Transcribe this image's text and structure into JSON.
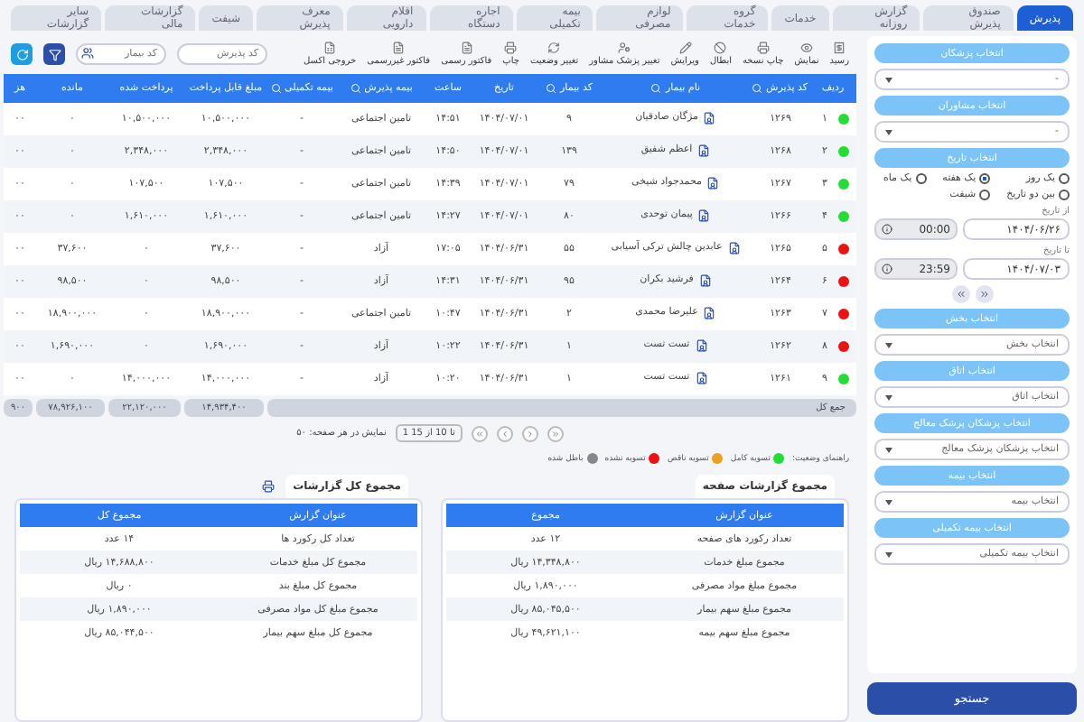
{
  "tabs": [
    {
      "label": "پذیرش",
      "selected": true
    },
    {
      "label": "صندوق پذیرش",
      "selected": false
    },
    {
      "label": "گزارش روزانه",
      "selected": false
    },
    {
      "label": "خدمات",
      "selected": false
    },
    {
      "label": "گروه خدمات",
      "selected": false
    },
    {
      "label": "لوازم مصرفی",
      "selected": false
    },
    {
      "label": "بیمه تکمیلی",
      "selected": false
    },
    {
      "label": "اجاره دستگاه",
      "selected": false
    },
    {
      "label": "اقلام دارویی",
      "selected": false
    },
    {
      "label": "معرف پذیرش",
      "selected": false
    },
    {
      "label": "شیفت",
      "selected": false
    },
    {
      "label": "گزارشات مالی",
      "selected": false
    },
    {
      "label": "سایر گزارشات",
      "selected": false
    }
  ],
  "toolbar": [
    {
      "label": "رسید"
    },
    {
      "label": "نمایش"
    },
    {
      "label": "چاپ نسخه"
    },
    {
      "label": "ابطال"
    },
    {
      "label": "ویرایش"
    },
    {
      "label": "تغییر پزشک مشاور"
    },
    {
      "label": "تغییر وضعیت"
    },
    {
      "label": "چاپ"
    },
    {
      "label": "فاکتور رسمی"
    },
    {
      "label": "فاکتور غیررسمی"
    },
    {
      "label": "خروجی اکسل"
    }
  ],
  "filters": {
    "admission_code": {
      "placeholder": "کد پذیرش"
    },
    "patient_code": {
      "placeholder": "کد بیمار"
    }
  },
  "table": {
    "columns": [
      {
        "label": "ردیف",
        "searchable": false
      },
      {
        "label": "کد پذیرش",
        "searchable": true
      },
      {
        "label": "نام بیمار",
        "searchable": true
      },
      {
        "label": "کد بیمار",
        "searchable": true
      },
      {
        "label": "تاریخ",
        "searchable": false
      },
      {
        "label": "ساعت",
        "searchable": false
      },
      {
        "label": "بیمه پذیرش",
        "searchable": true
      },
      {
        "label": "بیمه تکمیلی",
        "searchable": true
      },
      {
        "label": "مبلغ قابل پرداخت",
        "searchable": false
      },
      {
        "label": "پرداخت شده",
        "searchable": false
      },
      {
        "label": "مانده",
        "searchable": false
      },
      {
        "label": "هز",
        "searchable": false
      }
    ],
    "rows": [
      {
        "color": "#22dd33",
        "cells": [
          "۱",
          "۱۲۶۹",
          "مژگان صادقیان",
          "۹",
          "۱۴۰۴/۰۷/۰۱",
          "۱۴:۵۱",
          "تامین اجتماعی",
          "-",
          "۱۰,۵۰۰,۰۰۰",
          "۱۰,۵۰۰,۰۰۰",
          "۰",
          "۰۰"
        ]
      },
      {
        "color": "#22dd33",
        "cells": [
          "۲",
          "۱۲۶۸",
          "اعظم شفیق",
          "۱۳۹",
          "۱۴۰۴/۰۷/۰۱",
          "۱۴:۵۰",
          "تامین اجتماعی",
          "-",
          "۲,۳۴۸,۰۰۰",
          "۲,۳۴۸,۰۰۰",
          "۰",
          "۰۰"
        ]
      },
      {
        "color": "#22dd33",
        "cells": [
          "۳",
          "۱۲۶۷",
          "محمدجواد شیخی",
          "۷۹",
          "۱۴۰۴/۰۷/۰۱",
          "۱۴:۳۹",
          "تامین اجتماعی",
          "-",
          "۱۰۷,۵۰۰",
          "۱۰۷,۵۰۰",
          "۰",
          "۰۰"
        ]
      },
      {
        "color": "#22dd33",
        "cells": [
          "۴",
          "۱۲۶۶",
          "پیمان توحدی",
          "۸۰",
          "۱۴۰۴/۰۷/۰۱",
          "۱۴:۲۷",
          "تامین اجتماعی",
          "-",
          "۱,۶۱۰,۰۰۰",
          "۱,۶۱۰,۰۰۰",
          "۰",
          "۰۰"
        ]
      },
      {
        "color": "#ee1111",
        "cells": [
          "۵",
          "۱۲۶۵",
          "عابدین چالش ترکی آسیابی",
          "۵۵",
          "۱۴۰۴/۰۶/۳۱",
          "۱۷:۰۵",
          "آزاد",
          "-",
          "۳۷,۶۰۰",
          "۰",
          "۳۷,۶۰۰",
          "۰۰"
        ]
      },
      {
        "color": "#ee1111",
        "cells": [
          "۶",
          "۱۲۶۴",
          "فرشید بکران",
          "۹۵",
          "۱۴۰۴/۰۶/۳۱",
          "۱۴:۳۱",
          "آزاد",
          "-",
          "۹۸,۵۰۰",
          "۰",
          "۹۸,۵۰۰",
          "۰۰"
        ]
      },
      {
        "color": "#ee1111",
        "cells": [
          "۷",
          "۱۲۶۳",
          "علیرضا محمدی",
          "۲",
          "۱۴۰۴/۰۶/۳۱",
          "۱۰:۴۷",
          "تامین اجتماعی",
          "-",
          "۱۸,۹۰۰,۰۰۰",
          "۰",
          "۱۸,۹۰۰,۰۰۰",
          "۰۰"
        ]
      },
      {
        "color": "#ee1111",
        "cells": [
          "۸",
          "۱۲۶۲",
          "تست تست",
          "۱",
          "۱۴۰۴/۰۶/۳۱",
          "۱۰:۲۲",
          "آزاد",
          "-",
          "۱,۶۹۰,۰۰۰",
          "۰",
          "۱,۶۹۰,۰۰۰",
          "۰۰"
        ]
      },
      {
        "color": "#22dd33",
        "cells": [
          "۹",
          "۱۲۶۱",
          "تست تست",
          "۱",
          "۱۴۰۴/۰۶/۳۱",
          "۱۰:۲۰",
          "آزاد",
          "-",
          "۱۴,۰۰۰,۰۰۰",
          "۱۴,۰۰۰,۰۰۰",
          "۰",
          "۰۰"
        ]
      }
    ],
    "totals": {
      "label": "جمع کل",
      "values": [
        "۱۴,۹۳۴,۴۰۰",
        "۲۲,۱۲۰,۰۰۰",
        "۷۸,۹۲۶,۱۰۰",
        "۹۰۰"
      ]
    }
  },
  "pagination": {
    "range": "1 تا 10 از 15",
    "page_size": "نمایش در هر صفحه: ۵۰"
  },
  "legend": {
    "title": "راهنمای وضعیت:",
    "items": [
      {
        "label": "تسویه کامل",
        "color": "#22dd33"
      },
      {
        "label": "تسویه ناقص",
        "color": "#f0a020"
      },
      {
        "label": "تسویه نشده",
        "color": "#ee1111"
      },
      {
        "label": "باطل شده",
        "color": "#888888"
      }
    ]
  },
  "summaries": [
    {
      "title": "مجموع گزارشات صفحه",
      "printable": false,
      "columns": [
        "عنوان گزارش",
        "مجموع"
      ],
      "rows": [
        [
          "تعداد رکورد های صفحه",
          "۱۲ عدد"
        ],
        [
          "مجموع مبلغ خدمات",
          "۱۴,۳۴۸,۸۰۰ ریال"
        ],
        [
          "مجموع مبلغ مواد مصرفی",
          "۱,۸۹۰,۰۰۰ ریال"
        ],
        [
          "مجموع مبلغ سهم بیمار",
          "۸۵,۰۴۵,۵۰۰ ریال"
        ],
        [
          "مجموع مبلغ سهم بیمه",
          "۴۹,۶۲۱,۱۰۰ ریال"
        ]
      ]
    },
    {
      "title": "مجموع کل گزارشات",
      "printable": true,
      "columns": [
        "عنوان گزارش",
        "مجموع کل"
      ],
      "rows": [
        [
          "تعداد کل رکورد ها",
          "۱۴ عدد"
        ],
        [
          "مجموع کل مبلغ خدمات",
          "۱۴,۶۸۸,۸۰۰ ریال"
        ],
        [
          "مجموع کل مبلغ بند",
          "۰ ریال"
        ],
        [
          "مجموع مبلغ کل مواد مصرفی",
          "۱,۸۹۰,۰۰۰ ریال"
        ],
        [
          "مجموع کل مبلغ سهم بیمار",
          "۸۵,۰۴۴,۵۰۰ ریال"
        ]
      ]
    }
  ],
  "sidebar": {
    "items": [
      {
        "kind": "button",
        "label": "انتخاب پزشکان"
      },
      {
        "kind": "select",
        "value": "-"
      },
      {
        "kind": "button",
        "label": "انتخاب مشاوران"
      },
      {
        "kind": "select",
        "value": "-"
      },
      {
        "kind": "button",
        "label": "انتخاب تاریخ"
      },
      {
        "kind": "radios",
        "options": [
          {
            "label": "یک روز",
            "selected": false
          },
          {
            "label": "یک هفته",
            "selected": true
          },
          {
            "label": "یک ماه",
            "selected": false
          },
          {
            "label": "بین دو تاریخ",
            "selected": false
          },
          {
            "label": "شیفت",
            "selected": false
          }
        ]
      },
      {
        "kind": "date",
        "label": "از تاریخ",
        "date": "۱۴۰۴/۰۶/۲۶",
        "time": "00:00"
      },
      {
        "kind": "date",
        "label": "تا تاریخ",
        "date": "۱۴۰۴/۰۷/۰۳",
        "time": "23:59"
      },
      {
        "kind": "nav"
      },
      {
        "kind": "button",
        "label": "انتخاب بخش"
      },
      {
        "kind": "select",
        "value": "انتخاب بخش"
      },
      {
        "kind": "button",
        "label": "انتخاب اتاق"
      },
      {
        "kind": "select",
        "value": "انتخاب اتاق"
      },
      {
        "kind": "button",
        "label": "انتخاب پزشکان پزشک معالج"
      },
      {
        "kind": "select",
        "value": "انتخاب پزشکان پزشک معالج"
      },
      {
        "kind": "button",
        "label": "انتخاب بیمه"
      },
      {
        "kind": "select",
        "value": "انتخاب بیمه"
      },
      {
        "kind": "button",
        "label": "انتخاب بیمه تکمیلی"
      },
      {
        "kind": "select",
        "value": "انتخاب بیمه تکمیلی"
      }
    ],
    "search_button": "جستجو"
  }
}
